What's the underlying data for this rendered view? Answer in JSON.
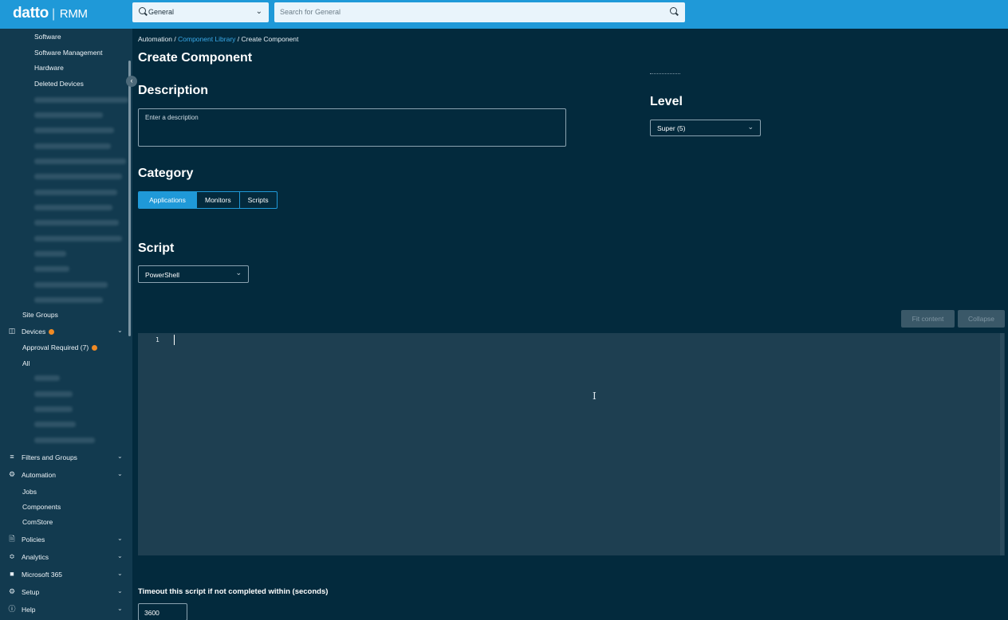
{
  "header": {
    "logo_brand": "datto",
    "logo_product": "RMM",
    "scope_value": "General",
    "search_placeholder": "Search for General"
  },
  "sidebar": {
    "sites_subitems": [
      "Software",
      "Software Management",
      "Hardware",
      "Deleted Devices"
    ],
    "site_groups": "Site Groups",
    "devices": {
      "label": "Devices",
      "approval": "Approval Required (7)",
      "all": "All"
    },
    "filters_groups": "Filters and Groups",
    "automation": {
      "label": "Automation",
      "items": [
        "Jobs",
        "Components",
        "ComStore"
      ]
    },
    "policies": "Policies",
    "analytics": "Analytics",
    "microsoft365": "Microsoft 365",
    "setup": "Setup",
    "help": "Help"
  },
  "breadcrumb": {
    "root": "Automation",
    "sep": "/",
    "link": "Component Library",
    "current": "Create Component"
  },
  "page_title": "Create Component",
  "description": {
    "heading": "Description",
    "placeholder": "Enter a description"
  },
  "level": {
    "heading": "Level",
    "value": "Super (5)"
  },
  "category": {
    "heading": "Category",
    "options": [
      "Applications",
      "Monitors",
      "Scripts"
    ],
    "selected": "Applications"
  },
  "script": {
    "heading": "Script",
    "language": "PowerShell"
  },
  "editor": {
    "fit_content": "Fit content",
    "collapse": "Collapse",
    "line_number": "1"
  },
  "timeout": {
    "label": "Timeout this script if not completed within (seconds)",
    "value": "3600"
  },
  "colors": {
    "accent": "#1f99d8",
    "background": "#032a3d",
    "sidebar": "#123a4f",
    "badge": "#f08a24"
  }
}
